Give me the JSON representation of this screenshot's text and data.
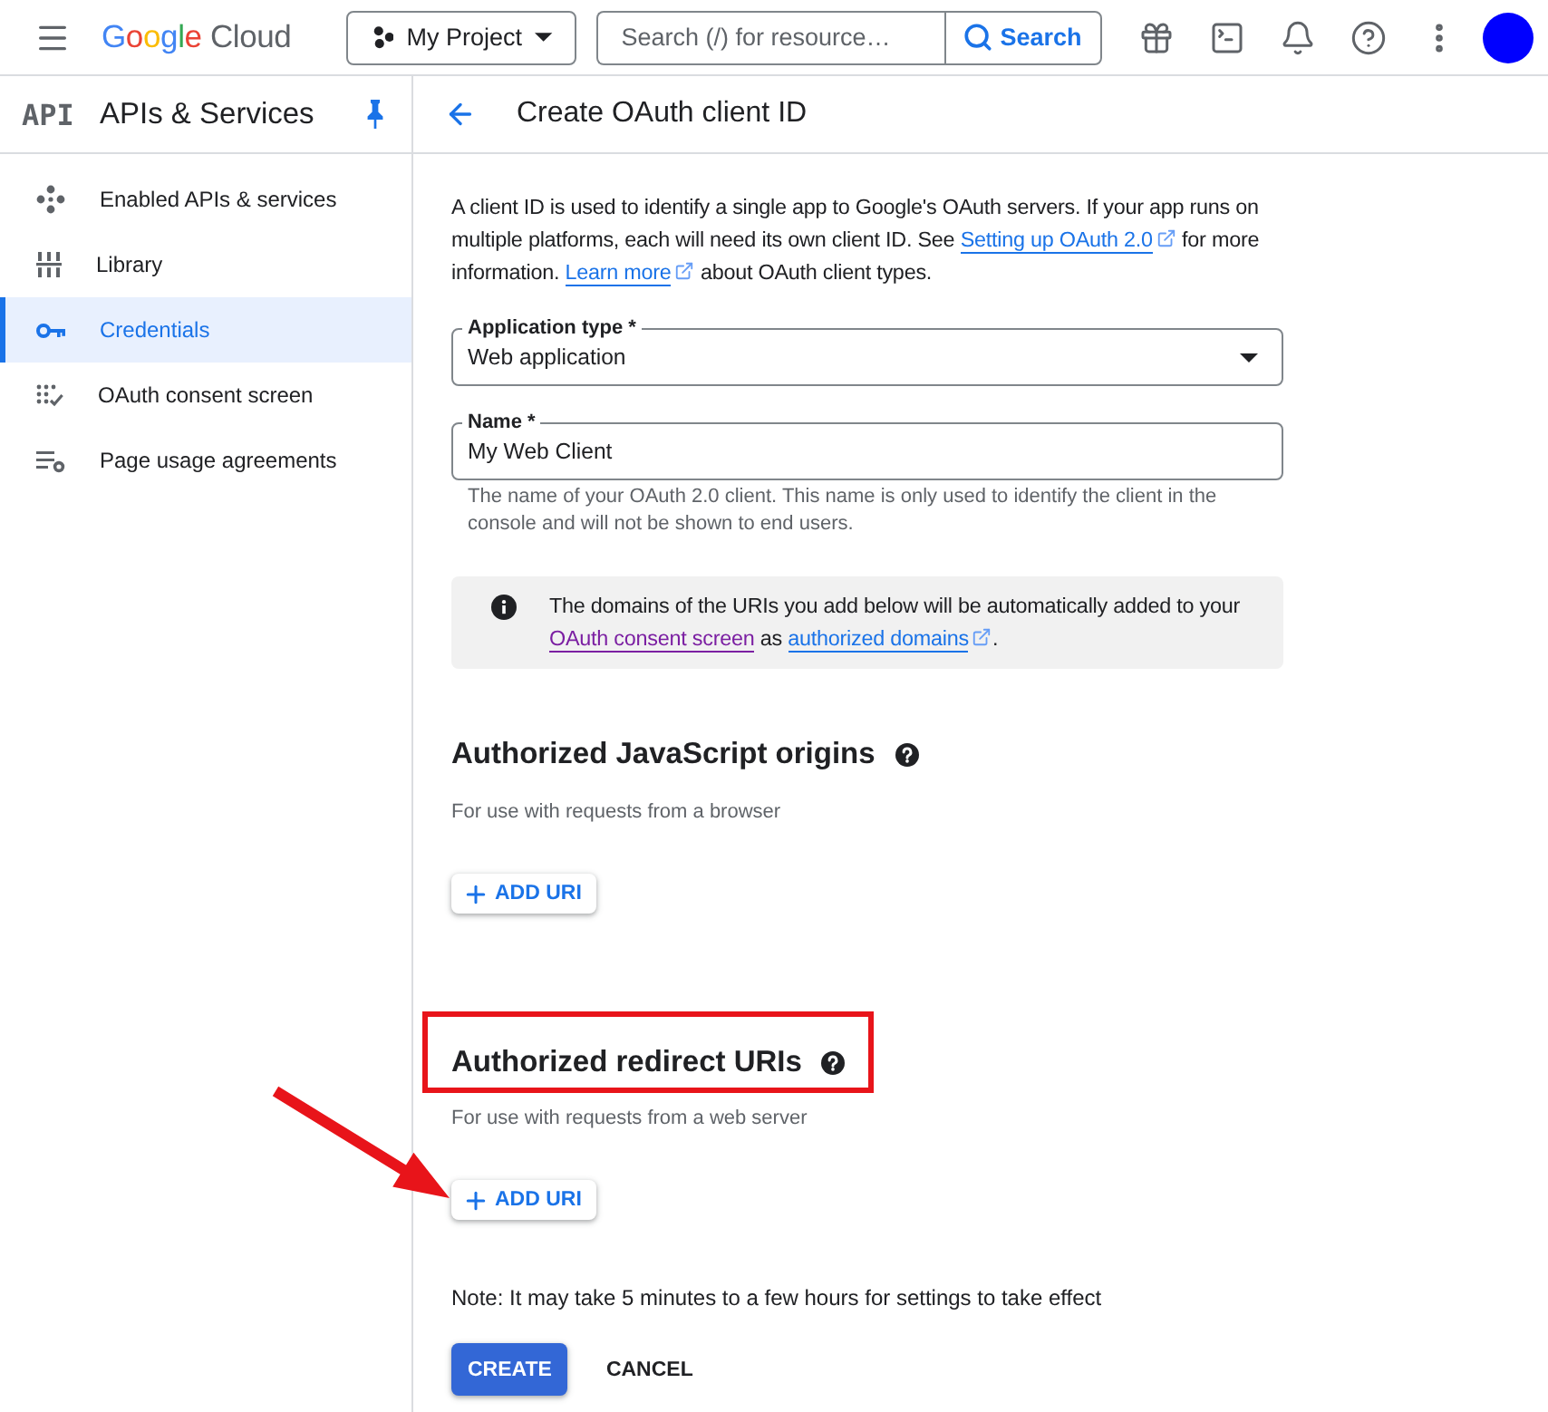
{
  "header": {
    "logo": {
      "brand": "Google",
      "product": "Cloud"
    },
    "project_picker": {
      "label": "My Project"
    },
    "search": {
      "placeholder": "Search (/) for resource…",
      "button": "Search"
    }
  },
  "sidebar": {
    "logo": "API",
    "title": "APIs & Services",
    "items": [
      {
        "label": "Enabled APIs & services",
        "selected": false
      },
      {
        "label": "Library",
        "selected": false
      },
      {
        "label": "Credentials",
        "selected": true
      },
      {
        "label": "OAuth consent screen",
        "selected": false
      },
      {
        "label": "Page usage agreements",
        "selected": false
      }
    ]
  },
  "page": {
    "title": "Create OAuth client ID"
  },
  "intro": [
    {
      "kind": "text",
      "text": "A client ID is used to identify a single app to Google's OAuth servers. If your app runs on multiple platforms, each will need its own client ID. See "
    },
    {
      "kind": "link",
      "text": "Setting up OAuth 2.0",
      "external": true,
      "visited": false
    },
    {
      "kind": "text",
      "text": " for more information. "
    },
    {
      "kind": "link",
      "text": "Learn more",
      "external": true,
      "visited": false
    },
    {
      "kind": "text",
      "text": " about OAuth client types."
    }
  ],
  "fields": [
    {
      "kind": "select",
      "label": "Application type *",
      "value": "Web application"
    },
    {
      "kind": "text",
      "label": "Name *",
      "value": "My Web Client",
      "helper": "The name of your OAuth 2.0 client. This name is only used to identify the client in the console and will not be shown to end users."
    }
  ],
  "info": [
    {
      "kind": "text",
      "text": "The domains of the URIs you add below will be automatically added to your "
    },
    {
      "kind": "link",
      "text": "OAuth consent screen",
      "external": false,
      "visited": true
    },
    {
      "kind": "text",
      "text": " as "
    },
    {
      "kind": "link",
      "text": "authorized domains",
      "external": true,
      "visited": false
    },
    {
      "kind": "text",
      "text": "."
    }
  ],
  "sections": [
    {
      "title": "Authorized JavaScript origins",
      "description": "For use with requests from a browser",
      "button": "ADD URI",
      "highlighted": false,
      "pointer_arrow": false
    },
    {
      "title": "Authorized redirect URIs",
      "description": "For use with requests from a web server",
      "button": "ADD URI",
      "highlighted": true,
      "pointer_arrow": true
    }
  ],
  "note": "Note: It may take 5 minutes to a few hours for settings to take effect",
  "actions": [
    {
      "kind": "primary",
      "label": "CREATE"
    },
    {
      "kind": "text",
      "label": "CANCEL"
    }
  ]
}
